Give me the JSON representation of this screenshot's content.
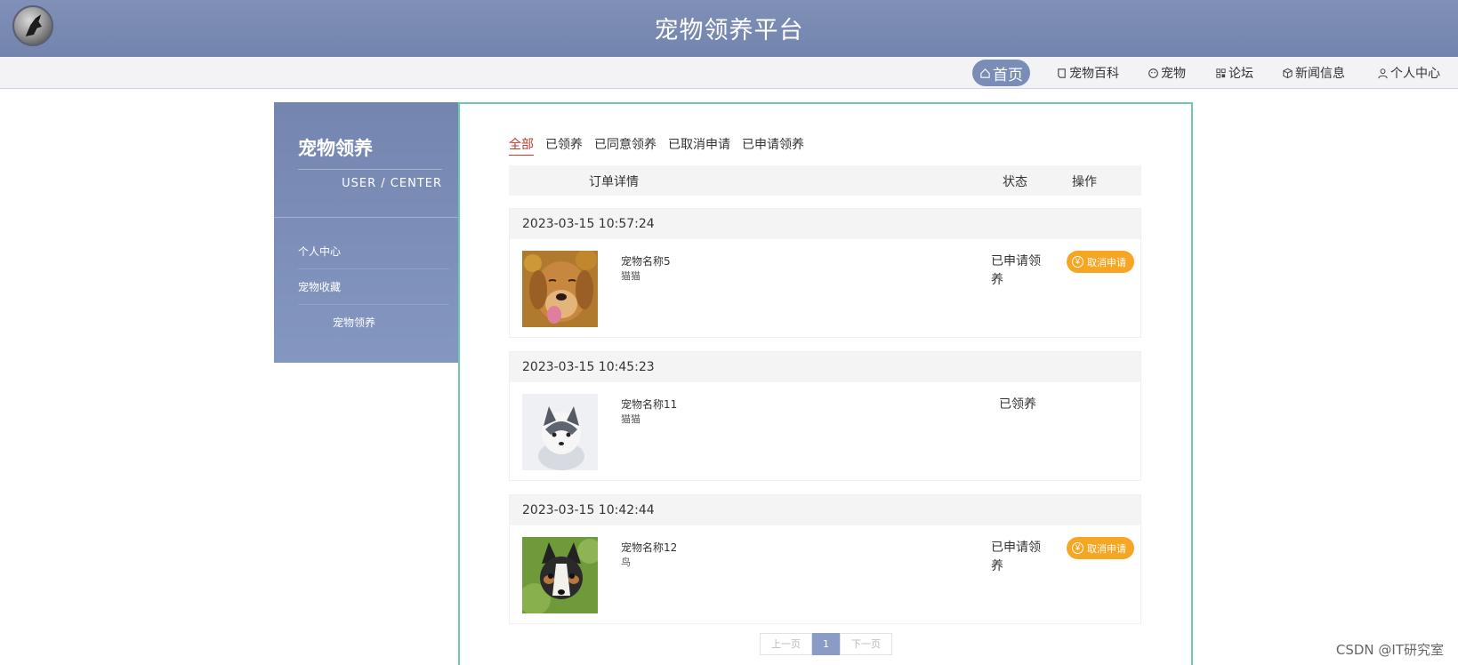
{
  "header": {
    "title": "宠物领养平台"
  },
  "nav": [
    {
      "label": "首页",
      "icon": "home-icon",
      "active": true
    },
    {
      "label": "宠物百科",
      "icon": "book-icon"
    },
    {
      "label": "宠物",
      "icon": "pet-icon"
    },
    {
      "label": "论坛",
      "icon": "grid-icon"
    },
    {
      "label": "新闻信息",
      "icon": "cube-icon"
    },
    {
      "label": "个人中心",
      "icon": "user-icon"
    }
  ],
  "sidebar": {
    "title": "宠物领养",
    "subtitle": "USER / CENTER",
    "items": [
      {
        "label": "个人中心"
      },
      {
        "label": "宠物收藏"
      },
      {
        "label": "宠物领养"
      }
    ]
  },
  "tabs": [
    {
      "label": "全部",
      "active": true
    },
    {
      "label": "已领养"
    },
    {
      "label": "已同意领养"
    },
    {
      "label": "已取消申请"
    },
    {
      "label": "已申请领养"
    }
  ],
  "table_header": {
    "detail": "订单详情",
    "status": "状态",
    "action": "操作"
  },
  "orders": [
    {
      "time": "2023-03-15 10:57:24",
      "name": "宠物名称5",
      "type": "猫猫",
      "status": "已申请领养",
      "action": "取消申请",
      "image": "golden-dog-photo"
    },
    {
      "time": "2023-03-15 10:45:23",
      "name": "宠物名称11",
      "type": "猫猫",
      "status": "已领养",
      "action": "",
      "image": "husky-puppy-photo"
    },
    {
      "time": "2023-03-15 10:42:44",
      "name": "宠物名称12",
      "type": "鸟",
      "status": "已申请领养",
      "action": "取消申请",
      "image": "chihuahua-photo"
    }
  ],
  "pagination": {
    "prev": "上一页",
    "current": "1",
    "next": "下一页"
  },
  "watermark": "CSDN @IT研究室",
  "colors": {
    "header": "#7284ad",
    "accent_btn": "#f5a623",
    "active_tab": "#c0392b",
    "panel_border": "#6fc8ad"
  }
}
